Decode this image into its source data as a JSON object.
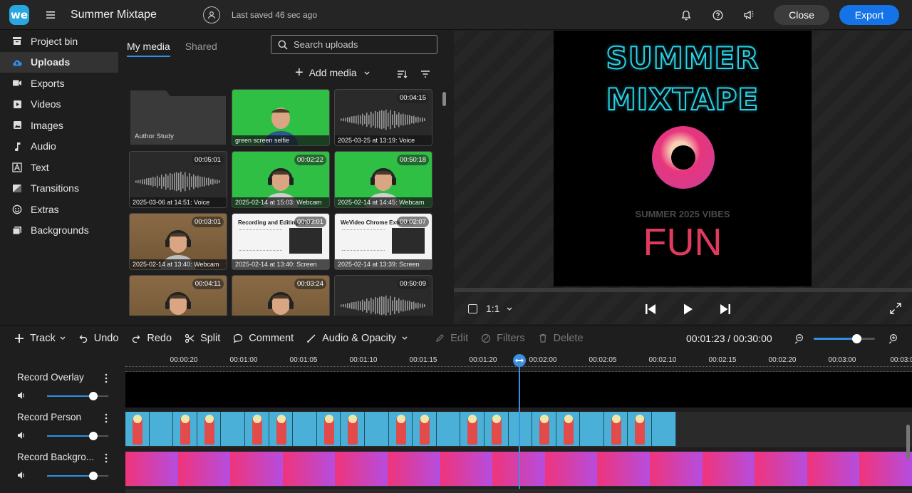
{
  "app": {
    "logo_text": "we",
    "project_title": "Summer Mixtape",
    "saved_status": "Last saved 46 sec ago",
    "close_label": "Close",
    "export_label": "Export",
    "accent_color": "#1473e6"
  },
  "sidebar": {
    "items": [
      {
        "label": "Project bin",
        "icon": "archive-icon"
      },
      {
        "label": "Uploads",
        "icon": "cloud-upload-icon",
        "active": true
      },
      {
        "label": "Exports",
        "icon": "video-camera-icon"
      },
      {
        "label": "Videos",
        "icon": "play-box-icon"
      },
      {
        "label": "Images",
        "icon": "image-icon"
      },
      {
        "label": "Audio",
        "icon": "music-note-icon"
      },
      {
        "label": "Text",
        "icon": "text-box-icon"
      },
      {
        "label": "Transitions",
        "icon": "transition-icon"
      },
      {
        "label": "Extras",
        "icon": "smiley-icon"
      },
      {
        "label": "Backgrounds",
        "icon": "backgrounds-icon"
      }
    ]
  },
  "media": {
    "tabs": [
      "My media",
      "Shared"
    ],
    "search_placeholder": "Search uploads",
    "add_media_label": "Add media",
    "folder": "Author Study",
    "items": [
      {
        "caption": "green screen selfie",
        "duration": "",
        "kind": "greenscreen"
      },
      {
        "caption": "2025-03-25 at 13:19: Voice",
        "duration": "00:04:15",
        "kind": "audio"
      },
      {
        "caption": "2025-03-06 at 14:51: Voice",
        "duration": "00:05:01",
        "kind": "audio"
      },
      {
        "caption": "2025-02-14 at 15:03: Webcam",
        "duration": "00:02:22",
        "kind": "greenscreen"
      },
      {
        "caption": "2025-02-14 at 14:45: Webcam",
        "duration": "00:50:18",
        "kind": "greenscreen"
      },
      {
        "caption": "2025-02-14 at 13:40: Webcam",
        "duration": "00:03:01",
        "kind": "office"
      },
      {
        "caption": "2025-02-14 at 13:40: Screen",
        "duration": "00:03:01",
        "kind": "doc",
        "doc_title": "Recording and Editing in W"
      },
      {
        "caption": "2025-02-14 at 13:39: Screen",
        "duration": "00:02:07",
        "kind": "doc",
        "doc_title": "WeVideo Chrome Extensio"
      },
      {
        "caption": "",
        "duration": "00:04:11",
        "kind": "office"
      },
      {
        "caption": "",
        "duration": "00:03:24",
        "kind": "office"
      },
      {
        "caption": "",
        "duration": "00:50:09",
        "kind": "audio"
      }
    ]
  },
  "preview": {
    "line1": "SUMMER",
    "line2": "MIXTAPE",
    "vibes": "SUMMER 2025 VIBES",
    "fun": "FUN",
    "aspect": "1:1",
    "title_color": "#27d0e6",
    "fun_color": "#e23a5e"
  },
  "toolbar": {
    "track": "Track",
    "undo": "Undo",
    "redo": "Redo",
    "split": "Split",
    "comment": "Comment",
    "audio_opacity": "Audio & Opacity",
    "edit": "Edit",
    "filters": "Filters",
    "delete": "Delete",
    "timecode": "00:01:23 / 00:30:00",
    "zoom_level": 0.7
  },
  "ruler": {
    "labels": [
      "00:00:20",
      "00:01:00",
      "00:01:05",
      "00:01:10",
      "00:01:15",
      "00:01:20",
      "00:02:00",
      "00:02:05",
      "00:02:10",
      "00:02:15",
      "00:02:20",
      "00:03:00",
      "00:03:0"
    ]
  },
  "tracks": [
    {
      "name": "Record Overlay",
      "volume": 0.75
    },
    {
      "name": "Record Person",
      "volume": 0.75
    },
    {
      "name": "Record Backgro...",
      "volume": 0.75
    }
  ]
}
